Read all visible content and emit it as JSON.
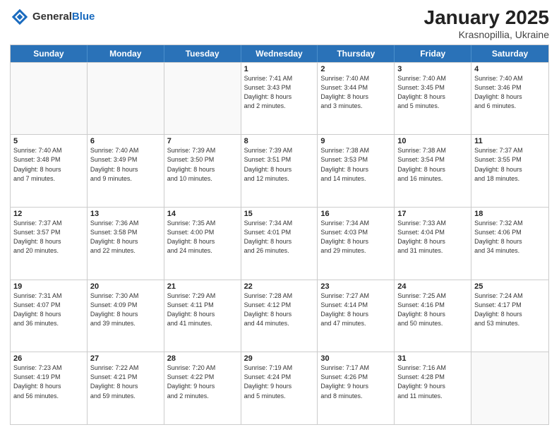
{
  "header": {
    "logo_general": "General",
    "logo_blue": "Blue",
    "month_title": "January 2025",
    "subtitle": "Krasnopillia, Ukraine"
  },
  "weekdays": [
    "Sunday",
    "Monday",
    "Tuesday",
    "Wednesday",
    "Thursday",
    "Friday",
    "Saturday"
  ],
  "rows": [
    [
      {
        "day": "",
        "info": ""
      },
      {
        "day": "",
        "info": ""
      },
      {
        "day": "",
        "info": ""
      },
      {
        "day": "1",
        "info": "Sunrise: 7:41 AM\nSunset: 3:43 PM\nDaylight: 8 hours\nand 2 minutes."
      },
      {
        "day": "2",
        "info": "Sunrise: 7:40 AM\nSunset: 3:44 PM\nDaylight: 8 hours\nand 3 minutes."
      },
      {
        "day": "3",
        "info": "Sunrise: 7:40 AM\nSunset: 3:45 PM\nDaylight: 8 hours\nand 5 minutes."
      },
      {
        "day": "4",
        "info": "Sunrise: 7:40 AM\nSunset: 3:46 PM\nDaylight: 8 hours\nand 6 minutes."
      }
    ],
    [
      {
        "day": "5",
        "info": "Sunrise: 7:40 AM\nSunset: 3:48 PM\nDaylight: 8 hours\nand 7 minutes."
      },
      {
        "day": "6",
        "info": "Sunrise: 7:40 AM\nSunset: 3:49 PM\nDaylight: 8 hours\nand 9 minutes."
      },
      {
        "day": "7",
        "info": "Sunrise: 7:39 AM\nSunset: 3:50 PM\nDaylight: 8 hours\nand 10 minutes."
      },
      {
        "day": "8",
        "info": "Sunrise: 7:39 AM\nSunset: 3:51 PM\nDaylight: 8 hours\nand 12 minutes."
      },
      {
        "day": "9",
        "info": "Sunrise: 7:38 AM\nSunset: 3:53 PM\nDaylight: 8 hours\nand 14 minutes."
      },
      {
        "day": "10",
        "info": "Sunrise: 7:38 AM\nSunset: 3:54 PM\nDaylight: 8 hours\nand 16 minutes."
      },
      {
        "day": "11",
        "info": "Sunrise: 7:37 AM\nSunset: 3:55 PM\nDaylight: 8 hours\nand 18 minutes."
      }
    ],
    [
      {
        "day": "12",
        "info": "Sunrise: 7:37 AM\nSunset: 3:57 PM\nDaylight: 8 hours\nand 20 minutes."
      },
      {
        "day": "13",
        "info": "Sunrise: 7:36 AM\nSunset: 3:58 PM\nDaylight: 8 hours\nand 22 minutes."
      },
      {
        "day": "14",
        "info": "Sunrise: 7:35 AM\nSunset: 4:00 PM\nDaylight: 8 hours\nand 24 minutes."
      },
      {
        "day": "15",
        "info": "Sunrise: 7:34 AM\nSunset: 4:01 PM\nDaylight: 8 hours\nand 26 minutes."
      },
      {
        "day": "16",
        "info": "Sunrise: 7:34 AM\nSunset: 4:03 PM\nDaylight: 8 hours\nand 29 minutes."
      },
      {
        "day": "17",
        "info": "Sunrise: 7:33 AM\nSunset: 4:04 PM\nDaylight: 8 hours\nand 31 minutes."
      },
      {
        "day": "18",
        "info": "Sunrise: 7:32 AM\nSunset: 4:06 PM\nDaylight: 8 hours\nand 34 minutes."
      }
    ],
    [
      {
        "day": "19",
        "info": "Sunrise: 7:31 AM\nSunset: 4:07 PM\nDaylight: 8 hours\nand 36 minutes."
      },
      {
        "day": "20",
        "info": "Sunrise: 7:30 AM\nSunset: 4:09 PM\nDaylight: 8 hours\nand 39 minutes."
      },
      {
        "day": "21",
        "info": "Sunrise: 7:29 AM\nSunset: 4:11 PM\nDaylight: 8 hours\nand 41 minutes."
      },
      {
        "day": "22",
        "info": "Sunrise: 7:28 AM\nSunset: 4:12 PM\nDaylight: 8 hours\nand 44 minutes."
      },
      {
        "day": "23",
        "info": "Sunrise: 7:27 AM\nSunset: 4:14 PM\nDaylight: 8 hours\nand 47 minutes."
      },
      {
        "day": "24",
        "info": "Sunrise: 7:25 AM\nSunset: 4:16 PM\nDaylight: 8 hours\nand 50 minutes."
      },
      {
        "day": "25",
        "info": "Sunrise: 7:24 AM\nSunset: 4:17 PM\nDaylight: 8 hours\nand 53 minutes."
      }
    ],
    [
      {
        "day": "26",
        "info": "Sunrise: 7:23 AM\nSunset: 4:19 PM\nDaylight: 8 hours\nand 56 minutes."
      },
      {
        "day": "27",
        "info": "Sunrise: 7:22 AM\nSunset: 4:21 PM\nDaylight: 8 hours\nand 59 minutes."
      },
      {
        "day": "28",
        "info": "Sunrise: 7:20 AM\nSunset: 4:22 PM\nDaylight: 9 hours\nand 2 minutes."
      },
      {
        "day": "29",
        "info": "Sunrise: 7:19 AM\nSunset: 4:24 PM\nDaylight: 9 hours\nand 5 minutes."
      },
      {
        "day": "30",
        "info": "Sunrise: 7:17 AM\nSunset: 4:26 PM\nDaylight: 9 hours\nand 8 minutes."
      },
      {
        "day": "31",
        "info": "Sunrise: 7:16 AM\nSunset: 4:28 PM\nDaylight: 9 hours\nand 11 minutes."
      },
      {
        "day": "",
        "info": ""
      }
    ]
  ]
}
